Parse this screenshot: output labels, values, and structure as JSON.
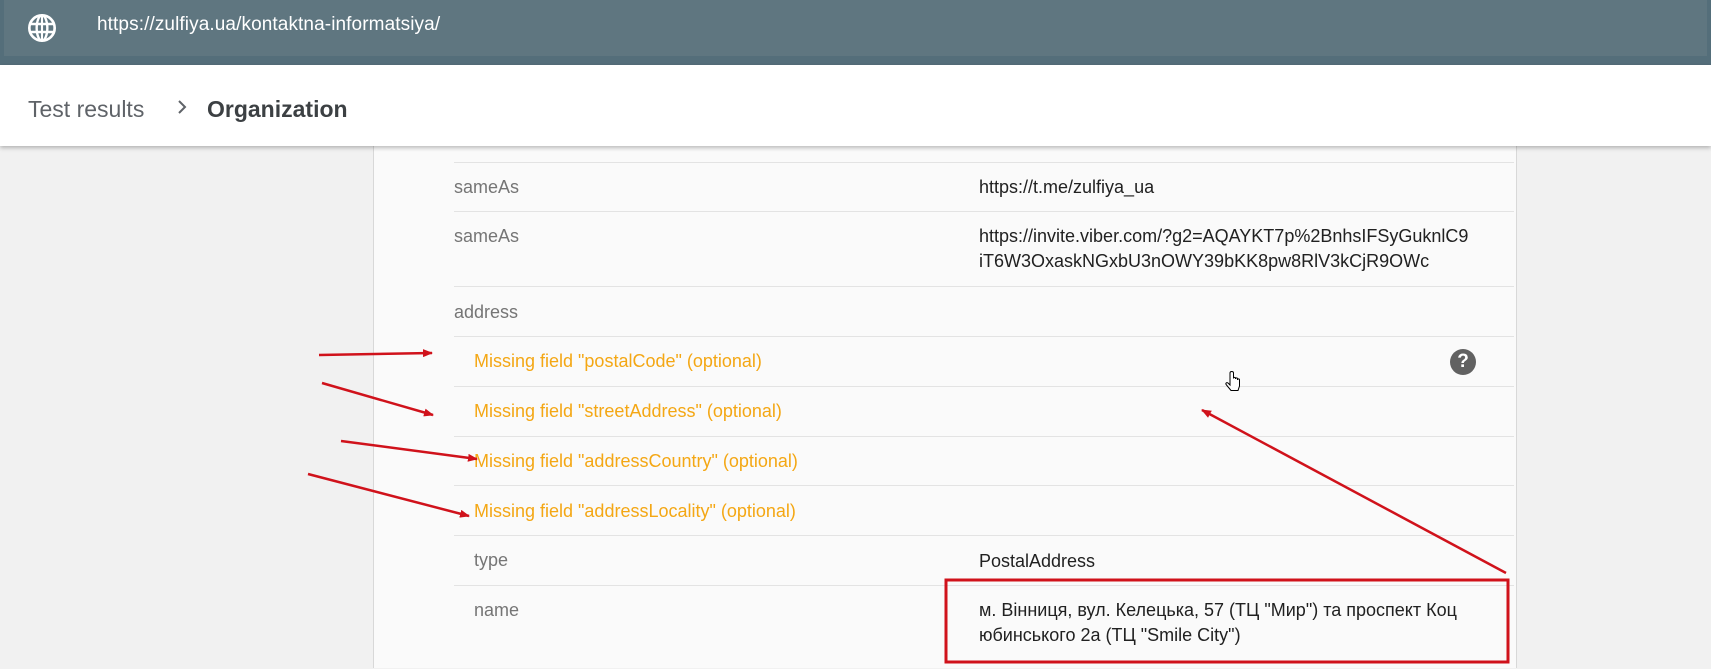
{
  "browser": {
    "url": "https://zulfiya.ua/kontaktna-informatsiya/"
  },
  "breadcrumb": {
    "parent": "Test results",
    "current": "Organization"
  },
  "rows": [
    {
      "key": "sameAs",
      "value": "https://t.me/zulfiya_ua"
    },
    {
      "key": "sameAs",
      "value_line1": "https://invite.viber.com/?g2=AQAYKT7p%2BnhsIFSyGuknlC9",
      "value_line2": "iT6W3OxaskNGxbU3nOWY39bKK8pw8RlV3kCjR9OWc"
    },
    {
      "key": "address"
    }
  ],
  "warnings": [
    "Missing field \"postalCode\" (optional)",
    "Missing field \"streetAddress\" (optional)",
    "Missing field \"addressCountry\" (optional)",
    "Missing field \"addressLocality\" (optional)"
  ],
  "address_fields": [
    {
      "key": "type",
      "value": "PostalAddress"
    },
    {
      "key": "name",
      "value_line1": "м. Вінниця, вул. Келецька, 57 (ТЦ \"Мир\") та проспект Коц",
      "value_line2": "юбинського 2а (ТЦ \"Smile City\")"
    }
  ],
  "help_icon_glyph": "?",
  "annotation_color": "#d0121b"
}
